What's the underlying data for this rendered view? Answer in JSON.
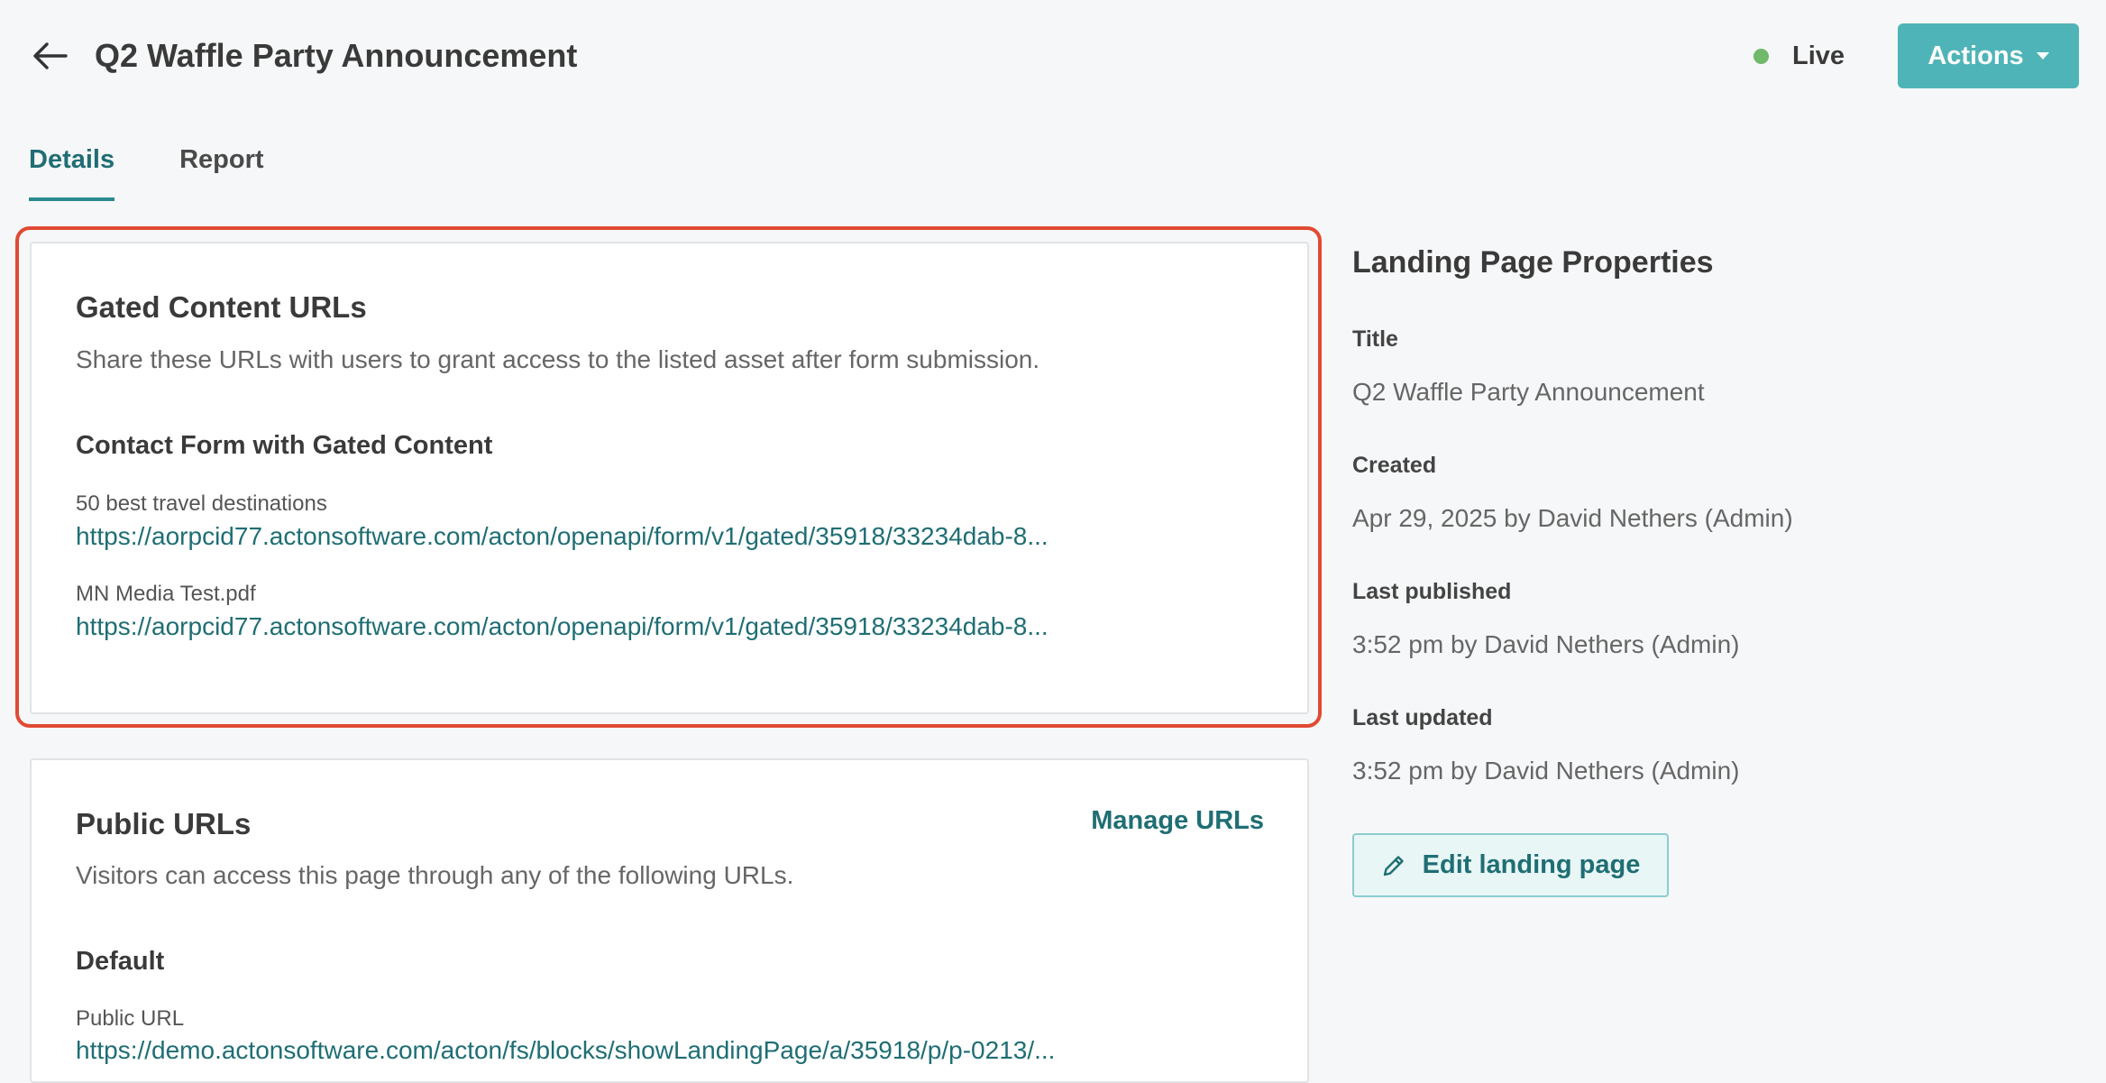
{
  "header": {
    "title": "Q2 Waffle Party Announcement",
    "status": "Live",
    "status_color": "#6fb96a",
    "actions_label": "Actions",
    "back_icon": "arrow-left-icon"
  },
  "tabs": [
    {
      "label": "Details",
      "active": true
    },
    {
      "label": "Report",
      "active": false
    }
  ],
  "gated": {
    "title": "Gated Content URLs",
    "description": "Share these URLs with users to grant access to the listed asset after form submission.",
    "form_name": "Contact Form with Gated Content",
    "assets": [
      {
        "label": "50 best travel destinations",
        "url": "https://aorpcid77.actonsoftware.com/acton/openapi/form/v1/gated/35918/33234dab-8..."
      },
      {
        "label": "MN Media Test.pdf",
        "url": "https://aorpcid77.actonsoftware.com/acton/openapi/form/v1/gated/35918/33234dab-8..."
      }
    ]
  },
  "public": {
    "title": "Public URLs",
    "manage_label": "Manage URLs",
    "description": "Visitors can access this page through any of the following URLs.",
    "section": "Default",
    "url_label": "Public URL",
    "url": "https://demo.actonsoftware.com/acton/fs/blocks/showLandingPage/a/35918/p/p-0213/..."
  },
  "properties": {
    "heading": "Landing Page Properties",
    "items": [
      {
        "label": "Title",
        "value": "Q2 Waffle Party Announcement"
      },
      {
        "label": "Created",
        "value": "Apr 29, 2025 by David Nethers (Admin)"
      },
      {
        "label": "Last published",
        "value": "3:52 pm by David Nethers (Admin)"
      },
      {
        "label": "Last updated",
        "value": "3:52 pm by David Nethers (Admin)"
      }
    ],
    "edit_label": "Edit landing page",
    "edit_icon": "pencil-icon"
  },
  "colors": {
    "accent": "#4fb4b8",
    "link": "#1f6e74",
    "highlight": "#e04a33"
  }
}
